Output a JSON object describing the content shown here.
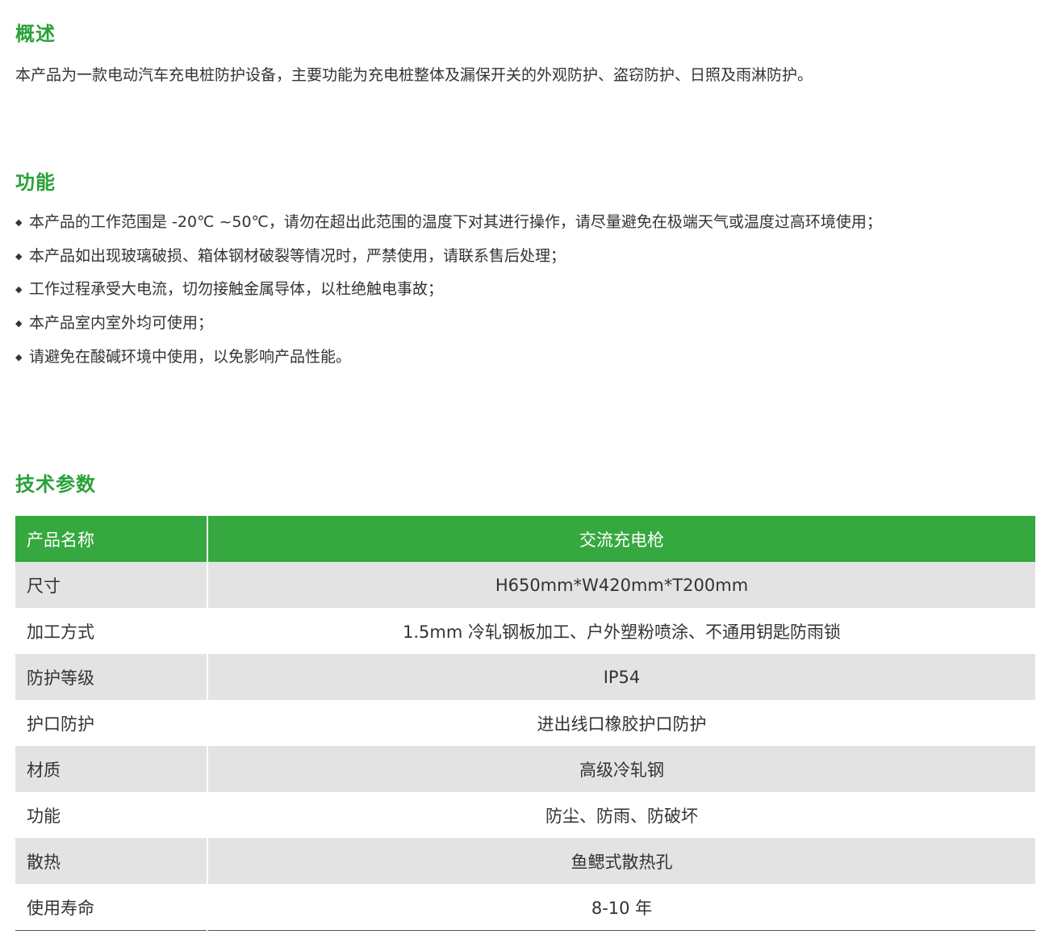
{
  "overview": {
    "heading": "概述",
    "text": "本产品为一款电动汽车充电桩防护设备，主要功能为充电桩整体及漏保开关的外观防护、盗窃防护、日照及雨淋防护。"
  },
  "functions": {
    "heading": "功能",
    "bullet_symbol": "◆",
    "items": [
      "本产品的工作范围是 -20℃ ~50℃，请勿在超出此范围的温度下对其进行操作，请尽量避免在极端天气或温度过高环境使用；",
      "本产品如出现玻璃破损、箱体钢材破裂等情况时，严禁使用，请联系售后处理；",
      "工作过程承受大电流，切勿接触金属导体，以杜绝触电事故；",
      "本产品室内室外均可使用；",
      "请避免在酸碱环境中使用，以免影响产品性能。"
    ]
  },
  "specs": {
    "heading": "技术参数",
    "header": {
      "name": "产品名称",
      "value": "交流充电枪"
    },
    "rows": [
      {
        "name": "尺寸",
        "value": "H650mm*W420mm*T200mm"
      },
      {
        "name": "加工方式",
        "value": "1.5mm 冷轧钢板加工、户外塑粉喷涂、不通用钥匙防雨锁"
      },
      {
        "name": "防护等级",
        "value": "IP54"
      },
      {
        "name": "护口防护",
        "value": "进出线口橡胶护口防护"
      },
      {
        "name": "材质",
        "value": "高级冷轧钢"
      },
      {
        "name": "功能",
        "value": "防尘、防雨、防破坏"
      },
      {
        "name": "散热",
        "value": "鱼鳃式散热孔"
      },
      {
        "name": "使用寿命",
        "value": "8-10 年"
      }
    ]
  },
  "colors": {
    "heading_green": "#2aa13a",
    "table_header_green": "#35a83f",
    "row_shade": "#e3e3e3",
    "body_text": "#333333"
  }
}
